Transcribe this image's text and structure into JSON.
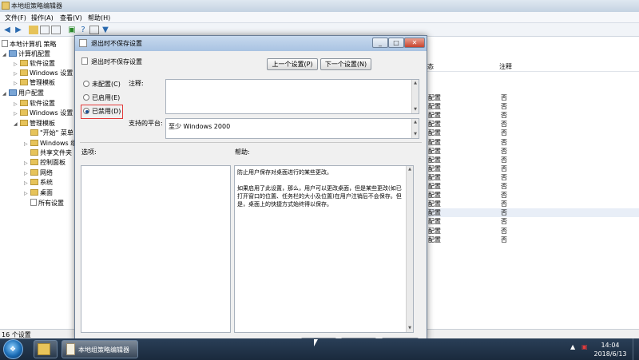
{
  "main_window": {
    "title": "本地组策略编辑器",
    "menu": [
      "文件(F)",
      "操作(A)",
      "查看(V)",
      "帮助(H)"
    ],
    "tree": [
      {
        "label": "本地计算机 策略",
        "icon": "doc-icon"
      },
      {
        "label": "计算机配置",
        "icon": "computer-icon"
      },
      {
        "label": "软件设置",
        "icon": "folder-icon"
      },
      {
        "label": "Windows 设置",
        "icon": "folder-icon"
      },
      {
        "label": "管理模板",
        "icon": "folder-icon"
      },
      {
        "label": "用户配置",
        "icon": "computer-icon"
      },
      {
        "label": "软件设置",
        "icon": "folder-icon"
      },
      {
        "label": "Windows 设置",
        "icon": "folder-icon"
      },
      {
        "label": "管理模板",
        "icon": "folder-icon"
      },
      {
        "label": "\"开始\" 菜单",
        "icon": "folder-icon"
      },
      {
        "label": "Windows 组",
        "icon": "folder-icon"
      },
      {
        "label": "共享文件夹",
        "icon": "folder-icon"
      },
      {
        "label": "控制面板",
        "icon": "folder-icon"
      },
      {
        "label": "网络",
        "icon": "folder-icon"
      },
      {
        "label": "系统",
        "icon": "folder-icon"
      },
      {
        "label": "桌面",
        "icon": "folder-icon"
      },
      {
        "label": "所有设置",
        "icon": "doc-icon"
      }
    ],
    "list": {
      "col_status": "态",
      "col_note": "注释",
      "rows": [
        {
          "status": "配置",
          "note": "否"
        },
        {
          "status": "配置",
          "note": "否"
        },
        {
          "status": "配置",
          "note": "否"
        },
        {
          "status": "配置",
          "note": "否"
        },
        {
          "status": "配置",
          "note": "否"
        },
        {
          "status": "配置",
          "note": "否"
        },
        {
          "status": "配置",
          "note": "否"
        },
        {
          "status": "配置",
          "note": "否"
        },
        {
          "status": "配置",
          "note": "否"
        },
        {
          "status": "配置",
          "note": "否"
        },
        {
          "status": "配置",
          "note": "否"
        },
        {
          "status": "配置",
          "note": "否"
        },
        {
          "status": "配置",
          "note": "否"
        },
        {
          "status": "配置",
          "note": "否"
        },
        {
          "status": "配置",
          "note": "否"
        },
        {
          "status": "配置",
          "note": "否"
        },
        {
          "status": "配置",
          "note": "否"
        }
      ]
    },
    "status": "16 个设置"
  },
  "dialog": {
    "title": "退出时不保存设置",
    "subtitle": "退出时不保存设置",
    "prev_button": "上一个设置(P)",
    "next_button": "下一个设置(N)",
    "radios": [
      {
        "label": "未配置(C)",
        "checked": false
      },
      {
        "label": "已启用(E)",
        "checked": false
      },
      {
        "label": "已禁用(D)",
        "checked": true
      }
    ],
    "comment_label": "注释:",
    "platform_label": "支持的平台:",
    "platform_value": "至少 Windows 2000",
    "options_label": "选项:",
    "help_label": "帮助:",
    "help_p1": "防止用户保存对桌面进行的某些更改。",
    "help_p2": "如果启用了此设置，那么，用户可以更改桌面，但是某些更改(如已打开窗口的位置、任务栏的大小及位置)在用户注销后不会保存。但是，桌面上的快捷方式始终得以保存。",
    "highlight_color": "#e23b3b"
  },
  "taskbar": {
    "app_label": "本地组策略编辑器",
    "time": "14:04",
    "date": "2018/6/13"
  }
}
